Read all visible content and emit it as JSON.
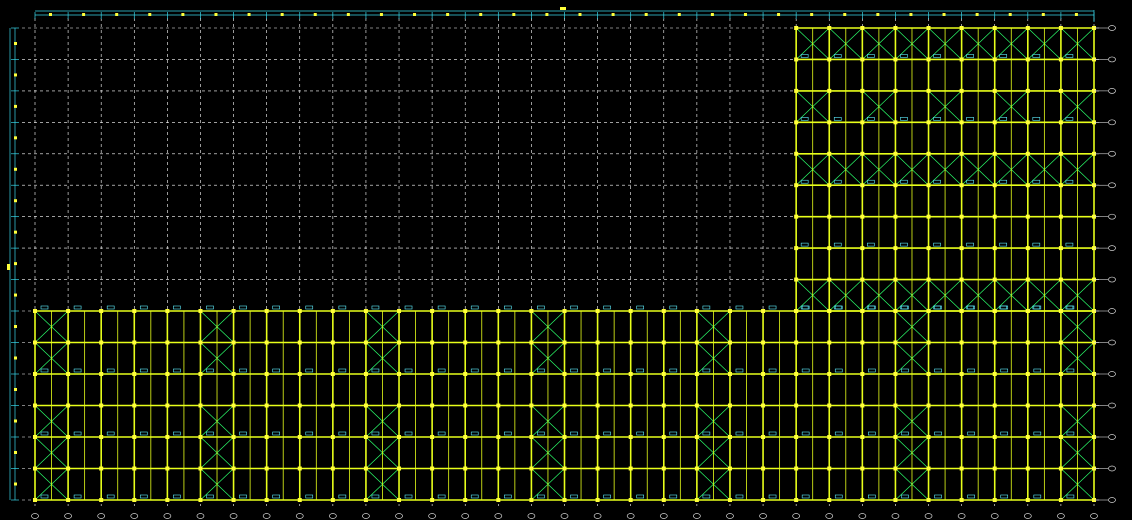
{
  "drawing": {
    "title": "",
    "colors": {
      "background": "#000000",
      "grid": "#ffffff",
      "beam": "#e8ff1a",
      "brace": "#2bff6a",
      "dimension": "#39d6e8",
      "tag": "#5ff0ff",
      "bubble": "#d8d8d8",
      "accent": "#ffff3a"
    }
  }
}
